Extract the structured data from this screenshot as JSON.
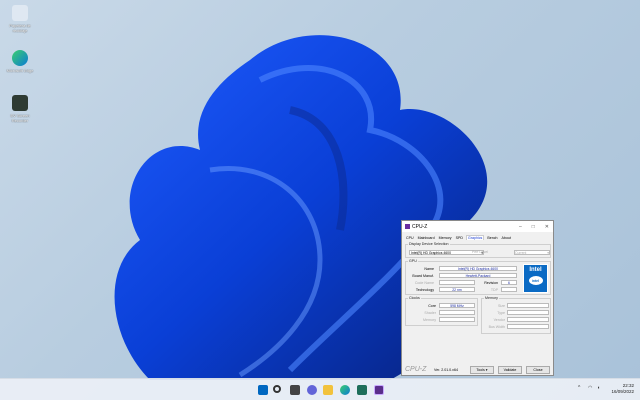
{
  "desktop": {
    "icons": [
      {
        "label": "Papelera de reciclaje",
        "icon": "recycle-bin-icon"
      },
      {
        "label": "Microsoft Edge",
        "icon": "edge-icon"
      },
      {
        "label": "EV Screen Recorder",
        "icon": "app-icon"
      }
    ]
  },
  "cpuz": {
    "title": "CPU-Z",
    "tabs": [
      "CPU",
      "Mainboard",
      "Memory",
      "SPD",
      "Graphics",
      "Bench",
      "About"
    ],
    "active_tab": "Graphics",
    "display_selection_label": "Display Device Selection",
    "device": "Intel(R) HD Graphics 4600",
    "perf_level_label": "Perf Level",
    "perf_level": "Current",
    "gpu_label": "GPU",
    "name_label": "Name",
    "name": "Intel(R) HD Graphics 4600",
    "board_label": "Board Manuf.",
    "board": "Hewlett-Packard",
    "code_label": "Code Name",
    "revision_label": "Revision",
    "revision": "6",
    "tech_label": "Technology",
    "tech": "22 nm",
    "tdp_label": "TDP",
    "clocks_label": "Clocks",
    "core_label": "Core",
    "core": "598 MHz",
    "shader_label": "Shader",
    "clk_memory_label": "Memory",
    "memory_label": "Memory",
    "size_label": "Size",
    "type_label": "Type",
    "vendor_label": "Vendor",
    "bus_label": "Bus Width",
    "logo": "intel",
    "brand": "CPU-Z",
    "version": "Ver. 2.01.0.x64",
    "tools": "Tools",
    "validate": "Validate",
    "close": "Close"
  },
  "taskbar": {
    "time": "22:32",
    "date": "16/09/2022",
    "accent": "#0067c0"
  }
}
